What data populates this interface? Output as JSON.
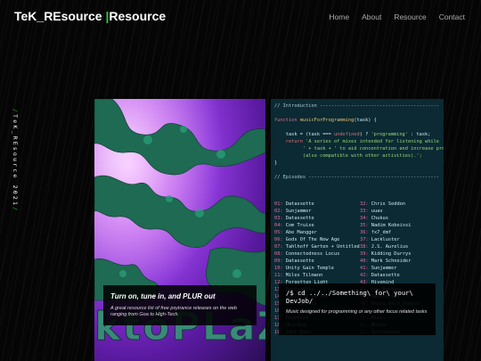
{
  "header": {
    "brand_main": "TeK_REsource",
    "brand_sep": " |",
    "brand_sub": "Resource",
    "nav": [
      "Home",
      "About",
      "Resource",
      "Contact"
    ]
  },
  "side": {
    "slash": "/",
    "text": "TeK_REsource 2021",
    "slash_end": "/"
  },
  "cards": {
    "left": {
      "art_text": "ktöPLaZr",
      "title": "Turn on, tune in, and PLUR out",
      "description": "A great resource list of free psytrance releases on the web ranging from Goa to High-Tech."
    },
    "right": {
      "title": "/$ cd ../../Something\\ for\\ your\\ DevJob/",
      "description": "Music designed for programming or any other focus related tasks"
    }
  },
  "terminal": {
    "intro_header": "// Introduction ------------------------------------------",
    "fn_kw": "function",
    "fn_name": "musicForProgramming",
    "fn_param": "(task)",
    "line1_a": "    task = (task === ",
    "line1_kw": "undefined",
    "line1_b": ") ? ",
    "line1_str": "'programming'",
    "line1_c": " : task;",
    "line2_kw": "    return",
    "line2_str": " 'A series of mixes intended for listening while",
    "line3_str": "          ' + task + ' to aid concentration and increase productiv",
    "line4_str": "          (also compatible with other activities).';",
    "close": "}",
    "episodes_header": "// Episodes ----------------------------------------------",
    "episodes": [
      {
        "n": "01:",
        "t": "Datassette"
      },
      {
        "n": "32:",
        "t": "Chris Seddon"
      },
      {
        "n": "02:",
        "t": "Sunjammer"
      },
      {
        "n": "33:",
        "t": "uuav"
      },
      {
        "n": "03:",
        "t": "Datassette"
      },
      {
        "n": "34:",
        "t": "Chukus"
      },
      {
        "n": "04:",
        "t": "Com Truise"
      },
      {
        "n": "35:",
        "t": "Nadim Kobeissi"
      },
      {
        "n": "05:",
        "t": "Abe Mangger"
      },
      {
        "n": "36:",
        "t": "fx7_dmf"
      },
      {
        "n": "06:",
        "t": "Gods Of The New Age"
      },
      {
        "n": "37:",
        "t": "Lackluster"
      },
      {
        "n": "07:",
        "t": "Tahlhoff Garten + Untitled"
      },
      {
        "n": "38:",
        "t": "J.S. Aurelius"
      },
      {
        "n": "08:",
        "t": "Connectedness Locus"
      },
      {
        "n": "39:",
        "t": "Kidding Durrys"
      },
      {
        "n": "09:",
        "t": "Datassette"
      },
      {
        "n": "40:",
        "t": "Mark Schneider"
      },
      {
        "n": "10:",
        "t": "Unity Gain Temple"
      },
      {
        "n": "41:",
        "t": "Sunjammer"
      },
      {
        "n": "11:",
        "t": "Miles Tilmann"
      },
      {
        "n": "42:",
        "t": "Datassette"
      },
      {
        "n": "12:",
        "t": "Forgotten Light"
      },
      {
        "n": "43:",
        "t": "Hivemind"
      },
      {
        "n": "13:",
        "t": "Datassette"
      },
      {
        "n": "44:",
        "t": "Abe Mangger"
      },
      {
        "n": "14:",
        "t": "Tahlhoff Garten"
      },
      {
        "n": "45:",
        "t": "Datassette"
      },
      {
        "n": "15:",
        "t": "Dan Adeyemi"
      },
      {
        "n": "46:",
        "t": "Unity Gain Temple"
      },
      {
        "n": "16:",
        "t": "Silent Strike"
      },
      {
        "n": "47:",
        "t": "Our Grey Lives"
      },
      {
        "n": "17:",
        "t": "Hivemind"
      },
      {
        "n": "50:",
        "t": "Misc."
      },
      {
        "n": "18:",
        "t": "Ubordog"
      },
      {
        "n": "51:",
        "t": "Mücha"
      },
      {
        "n": "19:",
        "t": "Idol Eyes"
      },
      {
        "n": "52:",
        "t": "Inchindown"
      }
    ]
  },
  "colors": {
    "accent": "#2ecc40",
    "terminal_bg": "#0b2a34"
  }
}
